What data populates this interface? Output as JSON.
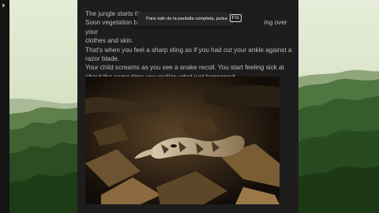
{
  "article": {
    "paragraphs": [
      "The jungle starts thi",
      "Soon vegetation bloc",
      "ing over your",
      "clothes and skin.",
      "That's when you feel a sharp sting as if you had cut your ankle against a razor blade.",
      "Your child screams as you see a snake recoil. You start feeling sick at about the same time you realize what just happened."
    ]
  },
  "fullscreen_notice": {
    "message": "Para salir de la pantalla completa, pulsa",
    "key": "F11"
  },
  "icons": {
    "sidebar_toggle": "chevron-right-icon"
  },
  "colors": {
    "panel_background": "#1d1d1d",
    "text": "#bdbdbd",
    "notice_background": "#262626"
  }
}
